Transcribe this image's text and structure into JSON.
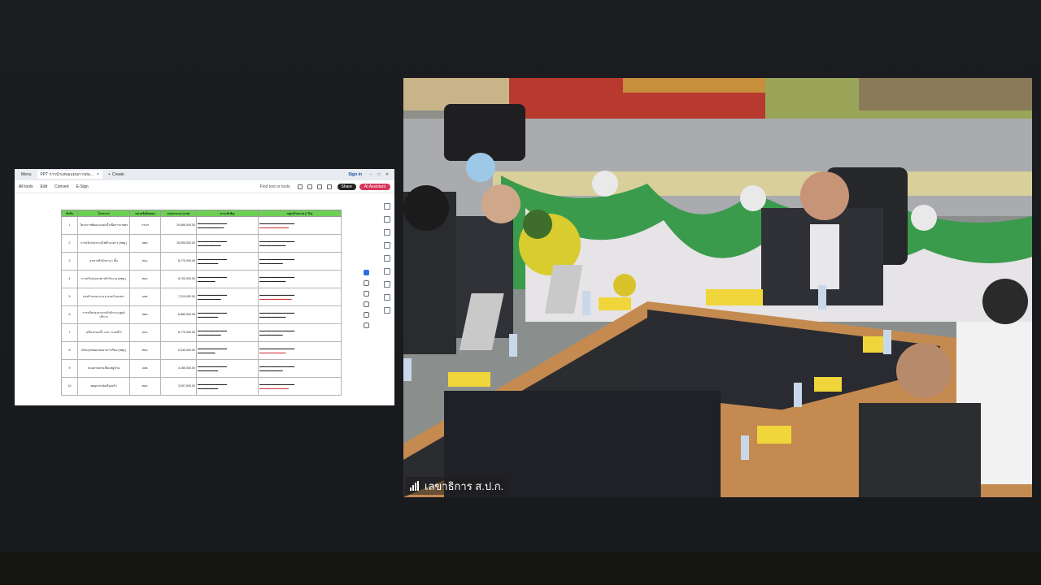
{
  "browser": {
    "tabs": [
      {
        "label": "Menu"
      },
      {
        "label": "PPT การนำเสนอแผนการต่อ..."
      },
      {
        "label": "Create"
      }
    ],
    "sign_in": "Sign in"
  },
  "pdf_toolbar": {
    "menu": [
      "All tools",
      "Edit",
      "Convert",
      "E-Sign"
    ],
    "find_placeholder": "Find text or tools",
    "share_label": "Share",
    "ai_label": "AI Assistant"
  },
  "table": {
    "headers": [
      "ลำดับ",
      "โครงการ",
      "หน่วยรับผิดชอบ",
      "งบประมาณ (บาท)",
      "สาระสำคัญ",
      "กลุ่มเป้าหมาย (7 กิจ)"
    ],
    "rows": [
      {
        "no": "1",
        "project": "โครงการพัฒนาแหล่งน้ำเพื่อการเกษตร",
        "unit": "กรมฯ",
        "budget": "29,465,000.00"
      },
      {
        "no": "2",
        "project": "การปรับปรุงระบบไฟฟ้าอาคาร (สพฐ.)",
        "unit": "สพป.",
        "budget": "15,905,000.00"
      },
      {
        "no": "3",
        "project": "อาคารสำนักงาน 1 ชั้น",
        "unit": "สนง.",
        "budget": "8,770,000.00"
      },
      {
        "no": "4",
        "project": "การปรับปรุงอาคารสำนักงาน (สพฐ.)",
        "unit": "ทสจ.",
        "budget": "8,700,000.00"
      },
      {
        "no": "5",
        "project": "ก่อสร้างถนน ค.ส.ล.สายบ้านเหล่า",
        "unit": "อบต.",
        "budget": "7,210,000.00"
      },
      {
        "no": "6",
        "project": "การปรับปรุงอาคารสำนักงาน ศูนย์บริการ",
        "unit": "สพป.",
        "budget": "6,880,000.00"
      },
      {
        "no": "7",
        "project": "เครื่องกรองน้ำ และ ระบบที่ 2",
        "unit": "สนง.",
        "budget": "6,770,000.00"
      },
      {
        "no": "8",
        "project": "ปรับปรุงซ่อมแซมอาคารเรียน (สพฐ.)",
        "unit": "ทสจ.",
        "budget": "5,330,000.00"
      },
      {
        "no": "9",
        "project": "ถนนลาดยางเชื่อมหมู่บ้าน",
        "unit": "อบต.",
        "budget": "4,160,000.00"
      },
      {
        "no": "10",
        "project": "ชุดอุปกรณ์เครื่องครัว",
        "unit": "ทสจ.",
        "budget": "3,097,000.00"
      }
    ]
  },
  "video": {
    "participant_name": "เลขาธิการ ส.ป.ก."
  },
  "colors": {
    "background": "#1a1c20",
    "table_header": "#6ecf55",
    "ai_button": "#d8365c"
  }
}
